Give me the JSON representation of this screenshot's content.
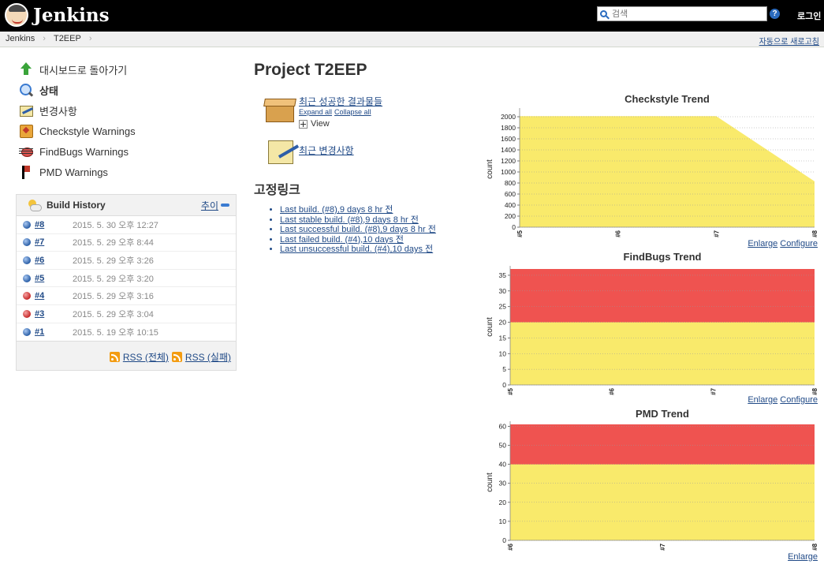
{
  "header": {
    "logo_text": "Jenkins",
    "search_placeholder": "검색",
    "help": "?",
    "login": "로그인"
  },
  "breadcrumb": {
    "items": [
      "Jenkins",
      "T2EEP"
    ],
    "separator": "›",
    "auto_refresh": "자동으로 새로고침"
  },
  "sidebar": {
    "items": [
      {
        "label": "대시보드로 돌아가기",
        "icon": "up-arrow-icon"
      },
      {
        "label": "상태",
        "icon": "magnifier-icon"
      },
      {
        "label": "변경사항",
        "icon": "notepad-icon"
      },
      {
        "label": "Checkstyle Warnings",
        "icon": "checkstyle-icon"
      },
      {
        "label": "FindBugs Warnings",
        "icon": "bug-icon"
      },
      {
        "label": "PMD Warnings",
        "icon": "pmd-flag-icon"
      }
    ]
  },
  "build_history": {
    "title": "Build History",
    "trend_link": "추이",
    "builds": [
      {
        "number": "#8",
        "date": "2015. 5. 30 오후 12:27",
        "status": "blue"
      },
      {
        "number": "#7",
        "date": "2015. 5. 29 오후 8:44",
        "status": "blue"
      },
      {
        "number": "#6",
        "date": "2015. 5. 29 오후 3:26",
        "status": "blue"
      },
      {
        "number": "#5",
        "date": "2015. 5. 29 오후 3:20",
        "status": "blue"
      },
      {
        "number": "#4",
        "date": "2015. 5. 29 오후 3:16",
        "status": "red"
      },
      {
        "number": "#3",
        "date": "2015. 5. 29 오후 3:04",
        "status": "red"
      },
      {
        "number": "#1",
        "date": "2015. 5. 19 오후 10:15",
        "status": "blue"
      }
    ],
    "rss_all": "RSS (전체)",
    "rss_failed": "RSS (실패)"
  },
  "main": {
    "title": "Project T2EEP",
    "artifacts_link": "최근 성공한 결과물들",
    "expand_all": "Expand all",
    "collapse_all": "Collapse all",
    "view_label": "View",
    "changes_link": "최근 변경사항",
    "permalinks_title": "고정링크",
    "permalinks": [
      "Last build. (#8),9 days 8 hr 전",
      "Last stable build. (#8),9 days 8 hr 전",
      "Last successful build. (#8),9 days 8 hr 전",
      "Last failed build. (#4),10 days 전",
      "Last unsuccessful build. (#4),10 days 전"
    ]
  },
  "colors": {
    "warning_yellow": "#f9ea6b",
    "error_red": "#ef5350",
    "link": "#204a87"
  },
  "chart_data": [
    {
      "type": "area",
      "title": "Checkstyle Trend",
      "ylabel": "count",
      "categories": [
        "#5",
        "#6",
        "#7",
        "#8"
      ],
      "ylim": [
        0,
        2100
      ],
      "yticks": [
        0,
        200,
        400,
        600,
        800,
        1000,
        1200,
        1400,
        1600,
        1800,
        2000
      ],
      "series": [
        {
          "values": [
            2010,
            2010,
            2010,
            830
          ],
          "color": "#f9ea6b"
        }
      ],
      "links": [
        "Enlarge",
        "Configure"
      ]
    },
    {
      "type": "area",
      "title": "FindBugs Trend",
      "ylabel": "count",
      "categories": [
        "#5",
        "#6",
        "#7",
        "#8"
      ],
      "ylim": [
        0,
        37
      ],
      "yticks": [
        0,
        5,
        10,
        15,
        20,
        25,
        30,
        35
      ],
      "series": [
        {
          "values": [
            20,
            20,
            20,
            20
          ],
          "color": "#f9ea6b"
        },
        {
          "values": [
            37,
            37,
            37,
            37
          ],
          "color": "#ef5350"
        }
      ],
      "links": [
        "Enlarge",
        "Configure"
      ]
    },
    {
      "type": "area",
      "title": "PMD Trend",
      "ylabel": "count",
      "categories": [
        "#6",
        "#7",
        "#8"
      ],
      "ylim": [
        0,
        61
      ],
      "yticks": [
        0,
        10,
        20,
        30,
        40,
        50,
        60
      ],
      "series": [
        {
          "values": [
            40,
            40,
            40
          ],
          "color": "#f9ea6b"
        },
        {
          "values": [
            61,
            61,
            61
          ],
          "color": "#ef5350"
        }
      ],
      "links": [
        "Enlarge"
      ]
    }
  ]
}
